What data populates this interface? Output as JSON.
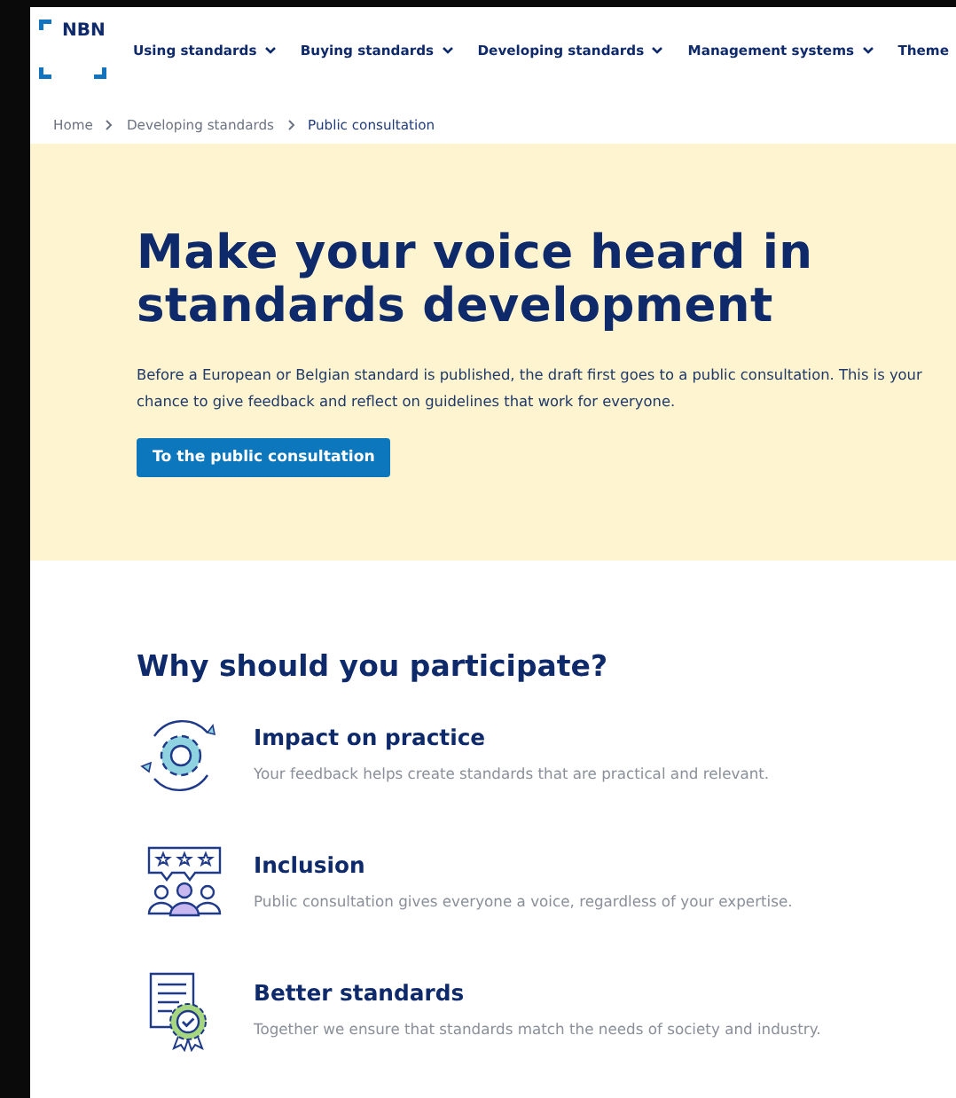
{
  "header": {
    "logo": "NBN",
    "nav": [
      {
        "label": "Using standards",
        "dropdown": true
      },
      {
        "label": "Buying standards",
        "dropdown": true
      },
      {
        "label": "Developing standards",
        "dropdown": true
      },
      {
        "label": "Management systems",
        "dropdown": true
      },
      {
        "label": "Theme",
        "dropdown": false
      }
    ]
  },
  "breadcrumb": [
    {
      "label": "Home",
      "current": false
    },
    {
      "label": "Developing standards",
      "current": false
    },
    {
      "label": "Public consultation",
      "current": true
    }
  ],
  "hero": {
    "title": "Make your voice heard in standards development",
    "text": "Before a European or Belgian standard is published, the draft first goes to a public consultation. This is your chance to give feedback and reflect on guidelines that work for everyone.",
    "button": "To the public consultation"
  },
  "reasons": {
    "heading": "Why should you participate?",
    "items": [
      {
        "kind": "gear",
        "title": "Impact on practice",
        "text": "Your feedback helps create standards that are practical and relevant."
      },
      {
        "kind": "people",
        "title": "Inclusion",
        "text": "Public consultation gives everyone a voice, regardless of your expertise."
      },
      {
        "kind": "certificate",
        "title": "Better standards",
        "text": "Together we ensure that standards match the needs of society and industry."
      }
    ]
  }
}
